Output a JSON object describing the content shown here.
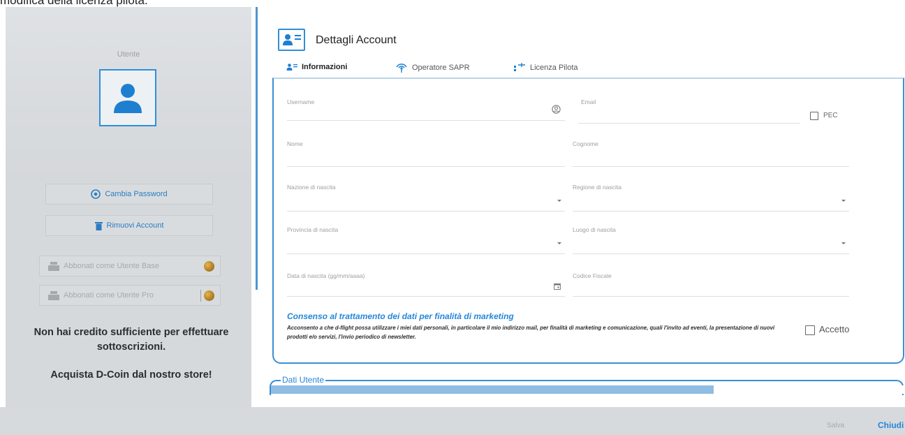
{
  "top_caption": "modifica della licenza pilota.",
  "sidebar": {
    "user_label": "Utente",
    "change_password": "Cambia Password",
    "remove_account": "Rimuovi Account",
    "subscribe_base": "Abbonati come Utente Base",
    "subscribe_pro": "Abbonati come Utente Pro",
    "no_credit": "Non hai credito sufficiente per effettuare sottoscrizioni.",
    "buy_coin": "Acquista D-Coin dal nostro store!"
  },
  "main": {
    "title": "Dettagli Account",
    "tabs": [
      {
        "label": "Informazioni"
      },
      {
        "label": "Operatore SAPR"
      },
      {
        "label": "Licenza Pilota"
      }
    ]
  },
  "form": {
    "username": "Username",
    "email": "Email",
    "pec": "PEC",
    "nome": "Nome",
    "cognome": "Cognome",
    "nazione": "Nazione di nascita",
    "regione": "Regione di nascita",
    "provincia": "Provincia di nascita",
    "luogo": "Luogo di nascita",
    "data": "Data di nascita (gg/mm/aaaa)",
    "codice_fiscale": "Codice Fiscale",
    "consent_title": "Consenso al trattamento dei dati per finalità di marketing",
    "consent_text": "Acconsento a che d-flight possa utilizzare i miei dati personali, in particolare il mio indirizzo mail, per finalità di marketing e comunicazione, quali l'invito ad eventi, la presentazione di nuovi prodotti e/o servizi, l'invio periodico di newsletter.",
    "accept": "Accetto"
  },
  "dati_utente": {
    "label": "Dati Utente",
    "progress": 0.7
  },
  "footer": {
    "save": "Salva",
    "close": "Chiudi"
  },
  "colors": {
    "accent": "#2586d8",
    "sidebar": "#d6d9dc"
  }
}
